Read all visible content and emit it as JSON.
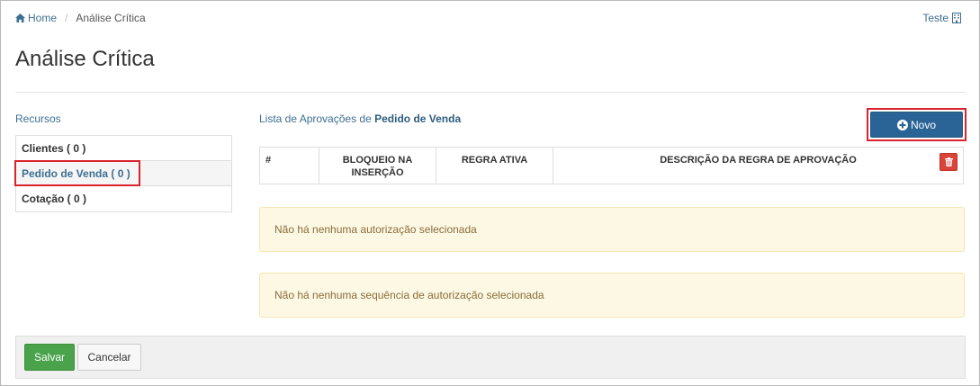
{
  "breadcrumb": {
    "home_label": "Home",
    "separator": "/",
    "current": "Análise Crítica"
  },
  "user": {
    "label": "Teste"
  },
  "page": {
    "title": "Análise Crítica"
  },
  "sidebar": {
    "section_label": "Recursos",
    "items": [
      {
        "label": "Clientes ( 0 )"
      },
      {
        "label": "Pedido de Venda ( 0 )"
      },
      {
        "label": "Cotação ( 0 )"
      }
    ],
    "active_index": 1
  },
  "main": {
    "list_title_prefix": "Lista de Aprovações de",
    "list_title_resource": "Pedido de Venda",
    "new_button_label": "Novo",
    "table": {
      "columns": [
        "#",
        "BLOQUEIO NA INSERÇÃO",
        "REGRA ATIVA",
        "DESCRIÇÃO DA REGRA DE APROVAÇÃO"
      ],
      "rows": []
    },
    "alerts": [
      "Não há nenhuma autorização selecionada",
      "Não há nenhuma sequência de autorização selecionada"
    ]
  },
  "footer": {
    "save_label": "Salvar",
    "cancel_label": "Cancelar"
  },
  "colors": {
    "link": "#3d6f92",
    "primary": "#2a6496",
    "success": "#4aa24a",
    "danger": "#d9453b",
    "highlight": "#d9232e",
    "alert_bg": "#fcf8e3"
  }
}
